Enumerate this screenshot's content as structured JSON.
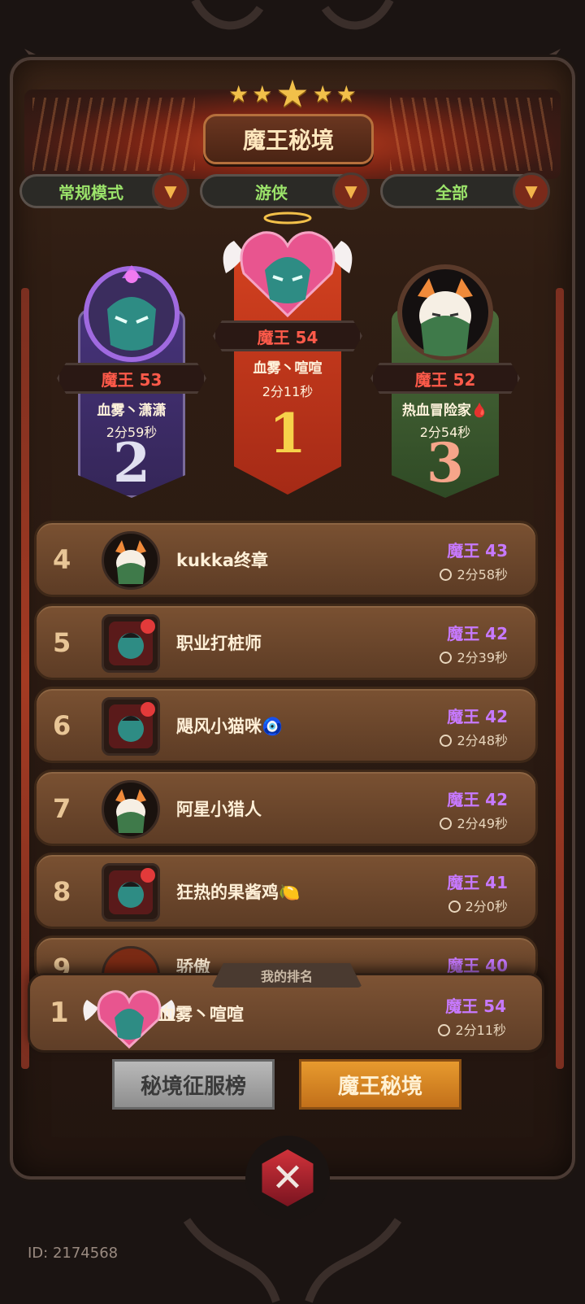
{
  "header": {
    "title": "魔王秘境",
    "stars": 5
  },
  "filters": [
    {
      "label": "常规模式"
    },
    {
      "label": "游侠"
    },
    {
      "label": "全部"
    }
  ],
  "podium": {
    "first": {
      "rank_label": "魔王 54",
      "name": "血雾丶喧喧",
      "time": "2分11秒",
      "place": "1"
    },
    "second": {
      "rank_label": "魔王 53",
      "name": "血雾丶潇潇",
      "time": "2分59秒",
      "place": "2"
    },
    "third": {
      "rank_label": "魔王 52",
      "name": "热血冒险家🩸",
      "time": "2分54秒",
      "place": "3"
    }
  },
  "list": [
    {
      "num": "4",
      "name": "kukka终章",
      "level": "魔王 43",
      "time": "2分58秒"
    },
    {
      "num": "5",
      "name": "职业打桩师",
      "level": "魔王 42",
      "time": "2分39秒"
    },
    {
      "num": "6",
      "name": "飓风小猫咪🧿",
      "level": "魔王 42",
      "time": "2分48秒"
    },
    {
      "num": "7",
      "name": "阿星小猎人",
      "level": "魔王 42",
      "time": "2分49秒"
    },
    {
      "num": "8",
      "name": "狂热的果酱鸡🍋",
      "level": "魔王 41",
      "time": "2分0秒"
    },
    {
      "num": "9",
      "name": "骄傲",
      "level": "魔王 40",
      "time": ""
    }
  ],
  "my_rank": {
    "tab_label": "我的排名",
    "num": "1",
    "name": "血雾丶喧喧",
    "level": "魔王 54",
    "time": "2分11秒"
  },
  "bottom_tabs": {
    "left": "秘境征服榜",
    "right": "魔王秘境"
  },
  "footer": {
    "uid": "ID: 2174568"
  },
  "colors": {
    "level_purple": "#c779ff",
    "podium_red": "#ff5a4a",
    "filter_green": "#9be36a"
  }
}
